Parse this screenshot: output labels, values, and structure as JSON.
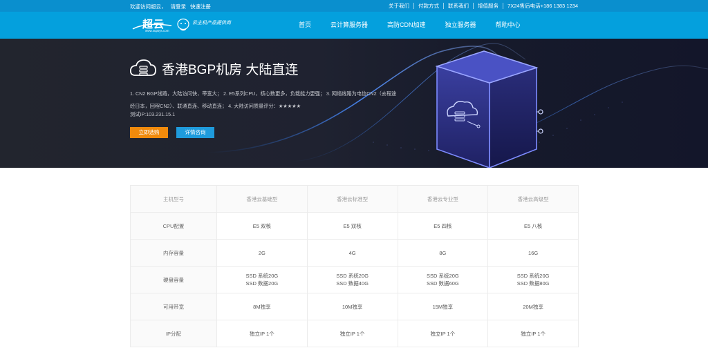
{
  "topbar": {
    "left": [
      "欢迎访问超云，",
      "请登录",
      "快速注册"
    ],
    "right": [
      "关于我们",
      "付款方式",
      "联系我们",
      "增值服务",
      "7X24售后电话+186 1383 1234"
    ]
  },
  "logo": {
    "brand": "超云",
    "domain": "www.supsys.com",
    "slogan": "云主机产品提供商"
  },
  "nav": {
    "items": [
      "首页",
      "云计算服务器",
      "高防CDN加速",
      "独立服务器",
      "帮助中心"
    ]
  },
  "banner": {
    "title": "香港BGP机房 大陆直连",
    "desc": "1. CN2 BGP线路，大陆访问快，带宽大； 2. E5系列CPU，核心数更多，负载能力更强； 3. 网络线路为电信CN2（去程途经日本，回程CN2）、联通直连、移动直连； 4. 大陆访问质量评分：★★★★★",
    "test_ip": "测试IP:103.231.15.1",
    "buy_label": "立即选购",
    "consult_label": "详情咨询"
  },
  "colors": {
    "topbar": "#0a8fce",
    "nav": "#04a0dd",
    "banner_dark": "#1f2230",
    "buy_button": "#f08a0c",
    "consult_button": "#1f9bdc"
  },
  "table": {
    "headers": [
      "主机型号",
      "香港云基础型",
      "香港云标准型",
      "香港云专业型",
      "香港云高级型"
    ],
    "rows": [
      {
        "label": "CPU配置",
        "cells": [
          "E5 双核",
          "E5 双核",
          "E5 四核",
          "E5 八核"
        ]
      },
      {
        "label": "内存容量",
        "cells": [
          "2G",
          "4G",
          "8G",
          "16G"
        ]
      },
      {
        "label": "硬盘容量",
        "cells": [
          "SSD 系统20G\nSSD 数据20G",
          "SSD 系统20G\nSSD 数据40G",
          "SSD 系统20G\nSSD 数据60G",
          "SSD 系统20G\nSSD 数据80G"
        ]
      },
      {
        "label": "可用带宽",
        "cells": [
          "8M独享",
          "10M独享",
          "15M独享",
          "20M独享"
        ]
      },
      {
        "label": "IP分配",
        "cells": [
          "独立IP 1个",
          "独立IP 1个",
          "独立IP 1个",
          "独立IP 1个"
        ]
      }
    ]
  }
}
